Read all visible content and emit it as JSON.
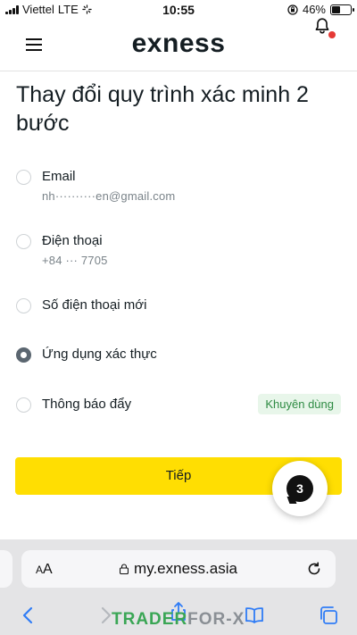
{
  "status_bar": {
    "carrier": "Viettel",
    "network": "LTE",
    "time": "10:55",
    "battery": "46%",
    "battery_level": 0.46
  },
  "header": {
    "logo": "exness",
    "has_notification": true
  },
  "page": {
    "title": "Thay đổi quy trình xác minh 2 bước",
    "options": [
      {
        "label": "Email",
        "sub": "nh··········en@gmail.com",
        "selected": false
      },
      {
        "label": "Điện thoại",
        "sub": "+84 ··· 7705",
        "selected": false
      },
      {
        "label": "Số điện thoại mới",
        "sub": "",
        "selected": false
      },
      {
        "label": "Ứng dụng xác thực",
        "sub": "",
        "selected": true
      },
      {
        "label": "Thông báo đẩy",
        "sub": "",
        "badge": "Khuyên dùng",
        "selected": false
      }
    ],
    "next_button": "Tiếp",
    "chat_count": "3"
  },
  "browser": {
    "text_size_small": "A",
    "text_size_large": "A",
    "url": "my.exness.asia"
  },
  "watermark": {
    "part1": "TRADER",
    "part2": "FOR-X"
  },
  "colors": {
    "accent": "#ffde02",
    "badge_bg": "#e8f6ea",
    "badge_text": "#2e8b43",
    "notification": "#e53935",
    "browser_blue": "#2f7cf6"
  }
}
